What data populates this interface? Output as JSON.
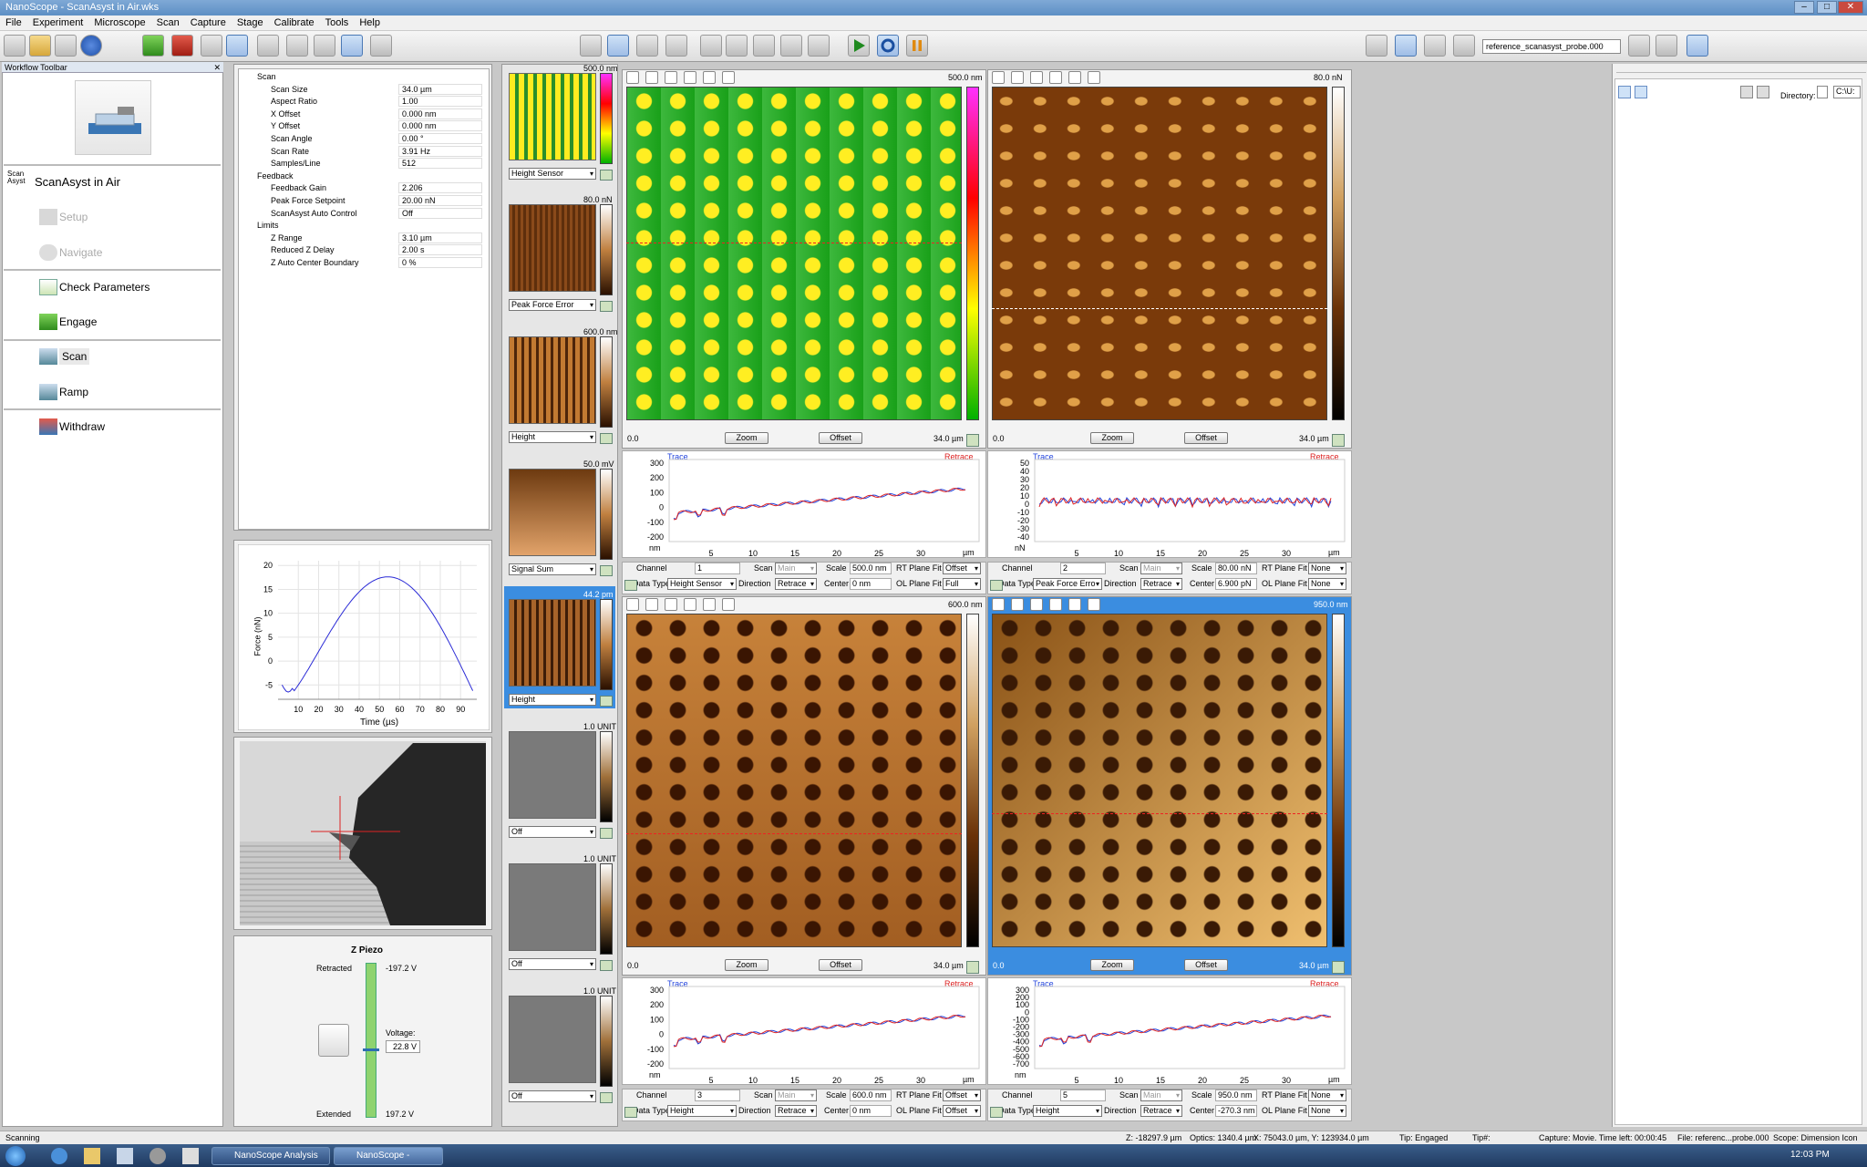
{
  "window": {
    "title": "NanoScope - ScanAsyst in Air.wks"
  },
  "menu": [
    "File",
    "Experiment",
    "Microscope",
    "Scan",
    "Capture",
    "Stage",
    "Calibrate",
    "Tools",
    "Help"
  ],
  "toolbar": {
    "probe_field": "reference_scanasyst_probe.000"
  },
  "workflow": {
    "header": "Workflow Toolbar",
    "mode": "ScanAsyst in Air",
    "mode_logo": "Scan Asyst",
    "items": [
      "Setup",
      "Navigate",
      "Check Parameters",
      "Engage",
      "Scan",
      "Ramp",
      "Withdraw"
    ]
  },
  "params": {
    "sections": [
      {
        "name": "Scan",
        "rows": [
          [
            "Scan Size",
            "34.0 µm"
          ],
          [
            "Aspect Ratio",
            "1.00"
          ],
          [
            "X Offset",
            "0.000 nm"
          ],
          [
            "Y Offset",
            "0.000 nm"
          ],
          [
            "Scan Angle",
            "0.00 °"
          ],
          [
            "Scan Rate",
            "3.91 Hz"
          ],
          [
            "Samples/Line",
            "512"
          ]
        ]
      },
      {
        "name": "Feedback",
        "rows": [
          [
            "Feedback Gain",
            "2.206"
          ],
          [
            "Peak Force Setpoint",
            "20.00 nN"
          ],
          [
            "ScanAsyst Auto Control",
            "Off"
          ]
        ]
      },
      {
        "name": "Limits",
        "rows": [
          [
            "Z Range",
            "3.10 µm"
          ],
          [
            "Reduced Z Delay",
            "2.00 s"
          ],
          [
            "Z Auto Center Boundary",
            "0 %"
          ]
        ]
      }
    ]
  },
  "force_plot": {
    "ylabel": "Force (nN)",
    "xlabel": "Time (µs)",
    "yticks": [
      "20",
      "15",
      "10",
      "5",
      "0",
      "-5"
    ],
    "xticks": [
      "10",
      "20",
      "30",
      "40",
      "50",
      "60",
      "70",
      "80",
      "90"
    ]
  },
  "zpiezo": {
    "title": "Z Piezo",
    "retracted_label": "Retracted",
    "retracted_val": "-197.2 V",
    "voltage_label": "Voltage:",
    "voltage_val": "22.8 V",
    "extended_label": "Extended",
    "extended_val": "197.2 V",
    "level": 0.56
  },
  "thumbs": [
    {
      "scale": "500.0 nm",
      "channel": "Height Sensor"
    },
    {
      "scale": "80.0 nN",
      "channel": "Peak Force Error"
    },
    {
      "scale": "600.0 nm",
      "channel": "Height"
    },
    {
      "scale": "50.0 mV",
      "channel": "Signal Sum"
    },
    {
      "scale": "44.2 pm",
      "channel": "Height"
    },
    {
      "scale": "1.0 UNIT",
      "channel": "Off"
    },
    {
      "scale": "1.0 UNIT",
      "channel": "Off"
    },
    {
      "scale": "1.0 UNIT",
      "channel": "Off"
    }
  ],
  "panels": [
    {
      "scale": "500.0 nm",
      "x0": "0.0",
      "x1": "34.0 µm",
      "zoom": "Zoom",
      "offset": "Offset",
      "trace": "Trace",
      "retrace": "Retrace",
      "unit": "nm",
      "yticks": [
        "300",
        "200",
        "100",
        "0",
        "-100",
        "-200"
      ],
      "xticks": [
        "5",
        "10",
        "15",
        "20",
        "25",
        "30"
      ],
      "xunit": "µm",
      "channel": "1",
      "scan": "Main",
      "scale_ctl": "500.0 nm",
      "rt": "Offset",
      "datatype": "Height Sensor",
      "direction": "Retrace",
      "center": "0 nm",
      "ol": "Full"
    },
    {
      "scale": "80.0 nN",
      "x0": "0.0",
      "x1": "34.0 µm",
      "zoom": "Zoom",
      "offset": "Offset",
      "trace": "Trace",
      "retrace": "Retrace",
      "unit": "nN",
      "yticks": [
        "50",
        "40",
        "30",
        "20",
        "10",
        "0",
        "-10",
        "-20",
        "-30",
        "-40"
      ],
      "xticks": [
        "5",
        "10",
        "15",
        "20",
        "25",
        "30"
      ],
      "xunit": "µm",
      "channel": "2",
      "scan": "Main",
      "scale_ctl": "80.00 nN",
      "rt": "None",
      "datatype": "Peak Force Erro",
      "direction": "Retrace",
      "center": "6.900 pN",
      "ol": "None"
    },
    {
      "scale": "600.0 nm",
      "x0": "0.0",
      "x1": "34.0 µm",
      "zoom": "Zoom",
      "offset": "Offset",
      "trace": "Trace",
      "retrace": "Retrace",
      "unit": "nm",
      "yticks": [
        "300",
        "200",
        "100",
        "0",
        "-100",
        "-200"
      ],
      "xticks": [
        "5",
        "10",
        "15",
        "20",
        "25",
        "30"
      ],
      "xunit": "µm",
      "channel": "3",
      "scan": "Main",
      "scale_ctl": "600.0 nm",
      "rt": "Offset",
      "datatype": "Height",
      "direction": "Retrace",
      "center": "0 nm",
      "ol": "Offset"
    },
    {
      "scale": "950.0 nm",
      "x0": "0.0",
      "x1": "34.0 µm",
      "zoom": "Zoom",
      "offset": "Offset",
      "trace": "Trace",
      "retrace": "Retrace",
      "unit": "nm",
      "yticks": [
        "300",
        "200",
        "100",
        "0",
        "-100",
        "-200",
        "-300",
        "-400",
        "-500",
        "-600",
        "-700"
      ],
      "xticks": [
        "5",
        "10",
        "15",
        "20",
        "25",
        "30"
      ],
      "xunit": "µm",
      "channel": "5",
      "scan": "Main",
      "scale_ctl": "950.0 nm",
      "rt": "None",
      "datatype": "Height",
      "direction": "Retrace",
      "center": "-270.3 nm",
      "ol": "None"
    }
  ],
  "ctl_labels": {
    "channel": "Channel",
    "scan": "Scan",
    "scale": "Scale",
    "rt": "RT Plane Fit",
    "datatype": "Data Type",
    "direction": "Direction",
    "center": "Center",
    "ol": "OL Plane Fit"
  },
  "right": {
    "directory_label": "Directory:",
    "directory_val": "C:\\U:"
  },
  "status": {
    "left": "Scanning",
    "z": "Z: -18297.9 µm",
    "optics": "Optics: 1340.4 µm",
    "xy": "X: 75043.0 µm, Y: 123934.0 µm",
    "tip": "Tip: Engaged",
    "tip2": "Tip#:",
    "capture": "Capture: Movie. Time left: 00:00:45",
    "file": "File: referenc...probe.000",
    "scope": "Scope: Dimension Icon"
  },
  "taskbar": {
    "apps": [
      "NanoScope Analysis",
      "NanoScope - ScanAs..."
    ],
    "time": "12:03 PM"
  }
}
